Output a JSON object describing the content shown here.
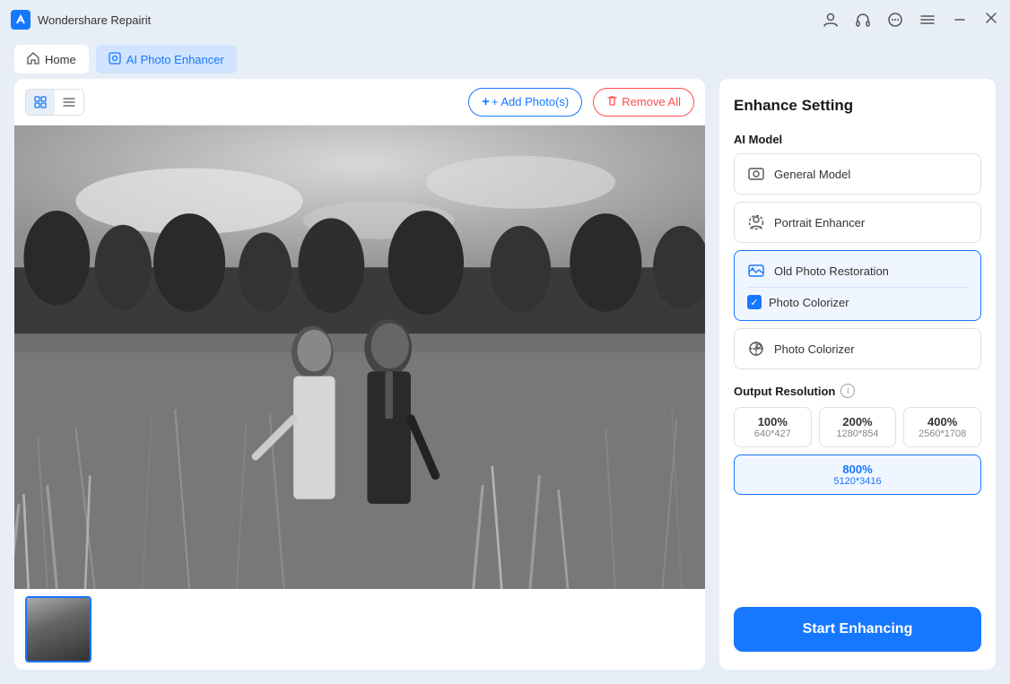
{
  "app": {
    "name": "Wondershare Repairit",
    "icon_label": "W"
  },
  "titlebar": {
    "icons": {
      "account": "👤",
      "headphones": "🎧",
      "chat": "💬",
      "menu": "☰",
      "minimize": "—",
      "close": "✕"
    }
  },
  "navbar": {
    "home_label": "Home",
    "active_label": "AI Photo Enhancer"
  },
  "toolbar": {
    "add_photos_label": "+ Add Photo(s)",
    "remove_all_label": "Remove All"
  },
  "panel": {
    "title": "Enhance Setting",
    "ai_model_label": "AI Model",
    "models": [
      {
        "id": "general",
        "label": "General Model",
        "active": false
      },
      {
        "id": "portrait",
        "label": "Portrait Enhancer",
        "active": false
      },
      {
        "id": "old_photo",
        "label": "Old Photo Restoration",
        "active": true
      },
      {
        "id": "photo_colorizer",
        "label": "Photo Colorizer",
        "active": false
      }
    ],
    "old_photo_sub_checkbox": "Photo Colorizer",
    "output_resolution_label": "Output Resolution",
    "resolutions": [
      {
        "percent": "100%",
        "size": "640*427",
        "active": false
      },
      {
        "percent": "200%",
        "size": "1280*854",
        "active": false
      },
      {
        "percent": "400%",
        "size": "2560*1708",
        "active": false
      }
    ],
    "active_resolution": {
      "percent": "800%",
      "size": "5120*3416"
    },
    "start_button_label": "Start Enhancing"
  }
}
